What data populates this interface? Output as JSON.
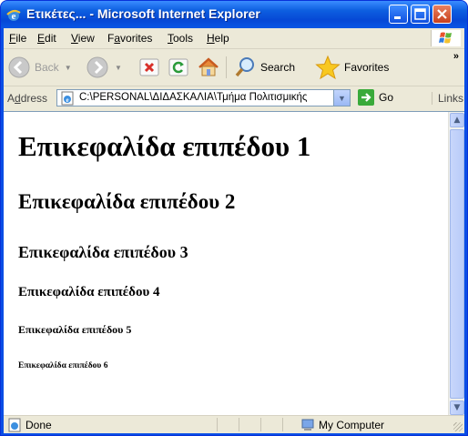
{
  "window": {
    "title": "Ετικέτες... - Microsoft Internet Explorer"
  },
  "menubar": {
    "items": [
      {
        "underline": "F",
        "rest": "ile"
      },
      {
        "underline": "E",
        "rest": "dit"
      },
      {
        "underline": "V",
        "rest": "iew"
      },
      {
        "pre": "F",
        "underline": "a",
        "rest": "vorites"
      },
      {
        "underline": "T",
        "rest": "ools"
      },
      {
        "underline": "H",
        "rest": "elp"
      }
    ]
  },
  "toolbar": {
    "back_label": "Back",
    "search_label": "Search",
    "favorites_label": "Favorites",
    "more": "»"
  },
  "addressbar": {
    "label_underline": "d",
    "label_pre": "A",
    "label_rest": "dress",
    "value": "C:\\PERSONAL\\ΔΙΔΑΣΚΑΛΙΑ\\Τμήμα Πολιτισμικής",
    "go_label": "Go",
    "links_label": "Links"
  },
  "content": {
    "h1": "Επικεφαλίδα επιπέδου 1",
    "h2": "Επικεφαλίδα επιπέδου 2",
    "h3": "Επικεφαλίδα επιπέδου 3",
    "h4": "Επικεφαλίδα επιπέδου 4",
    "h5": "Επικεφαλίδα επιπέδου 5",
    "h6": "Επικεφαλίδα επιπέδου 6"
  },
  "statusbar": {
    "status": "Done",
    "zone": "My Computer"
  },
  "colors": {
    "titlebar": "#0a56e5",
    "chrome": "#ece9d8",
    "close_button": "#c8401c"
  }
}
